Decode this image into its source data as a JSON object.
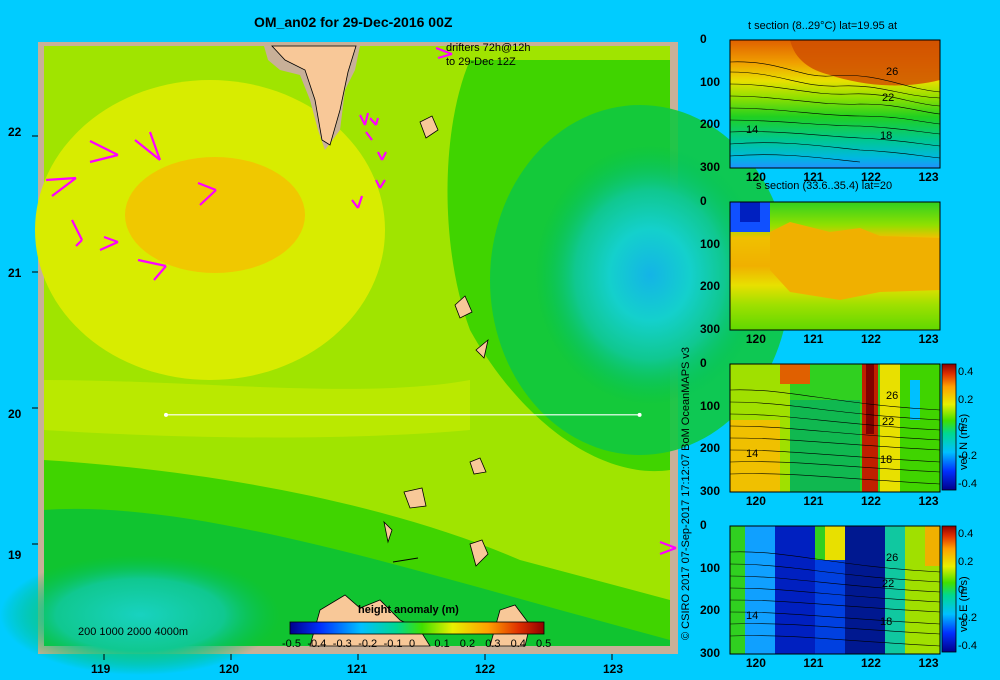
{
  "chart_data": [
    {
      "type": "heatmap",
      "title": "OM_an02 for 29-Dec-2016 00Z",
      "x_ticks": [
        "119",
        "120",
        "121",
        "122",
        "123"
      ],
      "y_ticks": [
        "22",
        "21",
        "20",
        "19"
      ],
      "xlim": [
        118.5,
        123.5
      ],
      "ylim": [
        18.3,
        22.65
      ],
      "section_line": {
        "lat": 20,
        "lon_start": 119.5,
        "lon_end": 123.2
      },
      "drifters_label_1": "drifters 72h@12h",
      "drifters_label_2": "to 29-Dec 12Z",
      "depth_legend": "200  1000  2000  4000m",
      "colorbar": {
        "label": "height anomaly (m)",
        "ticks": [
          "-0.5",
          "-0.4",
          "-0.3",
          "-0.2",
          "-0.1",
          "0",
          "0.1",
          "0.2",
          "0.3",
          "0.4",
          "0.5"
        ],
        "range": [
          -0.5,
          0.5
        ]
      }
    },
    {
      "type": "heatmap",
      "title": "t section (8..29°C) lat=19.95 at",
      "x_ticks": [
        "120",
        "121",
        "122",
        "123"
      ],
      "y_ticks": [
        "0",
        "100",
        "200",
        "300"
      ],
      "contour_labels": [
        "26",
        "22",
        "18",
        "14"
      ]
    },
    {
      "type": "heatmap",
      "title": "s section (33.6..35.4) lat=20",
      "x_ticks": [
        "120",
        "121",
        "122",
        "123"
      ],
      "y_ticks": [
        "0",
        "100",
        "200",
        "300"
      ]
    },
    {
      "type": "heatmap",
      "title": "vel. N (m/s)",
      "x_ticks": [
        "120",
        "121",
        "122",
        "123"
      ],
      "y_ticks": [
        "0",
        "100",
        "200",
        "300"
      ],
      "contour_labels": [
        "26",
        "22",
        "18",
        "14"
      ],
      "colorbar_ticks": [
        "0.4",
        "0.2",
        "0",
        "-0.2",
        "-0.4"
      ]
    },
    {
      "type": "heatmap",
      "title": "vel. E (m/s)",
      "x_ticks": [
        "120",
        "121",
        "122",
        "123"
      ],
      "y_ticks": [
        "0",
        "100",
        "200",
        "300"
      ],
      "contour_labels": [
        "26",
        "22",
        "18",
        "14"
      ],
      "colorbar_ticks": [
        "0.4",
        "0.2",
        "0",
        "-0.2",
        "-0.4"
      ]
    }
  ],
  "credit": "© CSIRO 2017   07-Sep-2017 17:12:07 BoM OceanMAPS v3"
}
